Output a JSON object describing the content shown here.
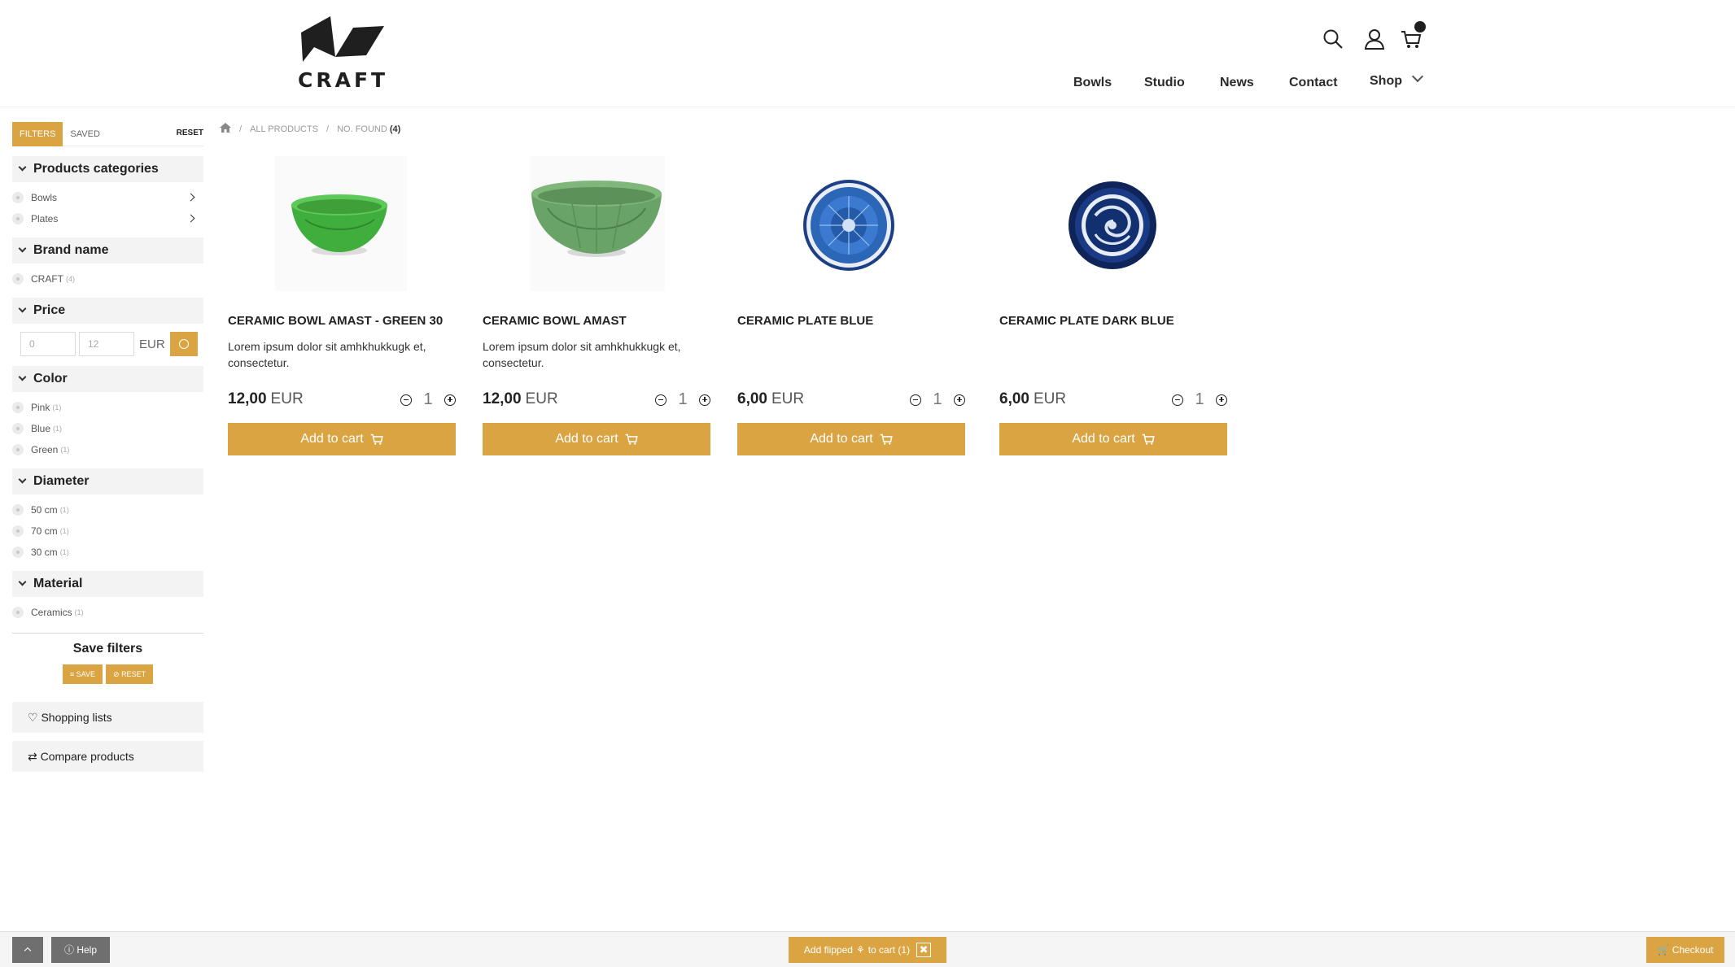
{
  "brand": {
    "logo_text": "CRAFT"
  },
  "header": {
    "icons": [
      "search-icon",
      "user-icon",
      "cart-icon"
    ],
    "nav": [
      {
        "label": "Bowls"
      },
      {
        "label": "Studio"
      },
      {
        "label": "News"
      },
      {
        "label": "Contact"
      },
      {
        "label": "Shop"
      }
    ]
  },
  "sidebar": {
    "tabs": {
      "filters": "FILTERS",
      "saved": "SAVED",
      "reset": "RESET"
    },
    "categories": {
      "title": "Products categories",
      "items": [
        {
          "label": "Bowls"
        },
        {
          "label": "Plates"
        }
      ]
    },
    "brand": {
      "title": "Brand name",
      "items": [
        {
          "label": "CRAFT",
          "count": "(4)"
        }
      ]
    },
    "price": {
      "title": "Price",
      "min_placeholder": "0",
      "max_placeholder": "12",
      "currency": "EUR"
    },
    "color": {
      "title": "Color",
      "items": [
        {
          "label": "Pink",
          "count": "(1)"
        },
        {
          "label": "Blue",
          "count": "(1)"
        },
        {
          "label": "Green",
          "count": "(1)"
        }
      ]
    },
    "diameter": {
      "title": "Diameter",
      "items": [
        {
          "label": "50 cm",
          "count": "(1)"
        },
        {
          "label": "70 cm",
          "count": "(1)"
        },
        {
          "label": "30 cm",
          "count": "(1)"
        }
      ]
    },
    "material": {
      "title": "Material",
      "items": [
        {
          "label": "Ceramics",
          "count": "(1)"
        }
      ]
    },
    "save_filters": {
      "title": "Save filters",
      "save": "SAVE",
      "reset": "RESET"
    },
    "shopping_lists": "Shopping lists",
    "compare_products": "Compare products"
  },
  "breadcrumb": {
    "separator": "/",
    "all_products": "ALL PRODUCTS",
    "found_label": "NO. FOUND",
    "found_count": "(4)"
  },
  "products": [
    {
      "name": "CERAMIC BOWL AMAST - GREEN 30",
      "description": "Lorem ipsum dolor sit amhkhukkugk et, consectetur.",
      "price": "12,00",
      "currency": "EUR",
      "qty": "1",
      "button": "Add to cart",
      "image": "green-bowl-small"
    },
    {
      "name": "CERAMIC BOWL AMAST",
      "description": "Lorem ipsum dolor sit amhkhukkugk et, consectetur.",
      "price": "12,00",
      "currency": "EUR",
      "qty": "1",
      "button": "Add to cart",
      "image": "green-bowl-large"
    },
    {
      "name": "CERAMIC PLATE BLUE",
      "description": "",
      "price": "6,00",
      "currency": "EUR",
      "qty": "1",
      "button": "Add to cart",
      "image": "blue-plate"
    },
    {
      "name": "CERAMIC PLATE DARK BLUE",
      "description": "",
      "price": "6,00",
      "currency": "EUR",
      "qty": "1",
      "button": "Add to cart",
      "image": "dark-blue-plate"
    }
  ],
  "bottom_bar": {
    "help": "Help",
    "flipped_pre": "Add flipped",
    "flipped_post": "to cart (1)",
    "checkout": "Checkout"
  },
  "colors": {
    "accent": "#d9a441",
    "bar_dark": "#6f6f6f"
  }
}
